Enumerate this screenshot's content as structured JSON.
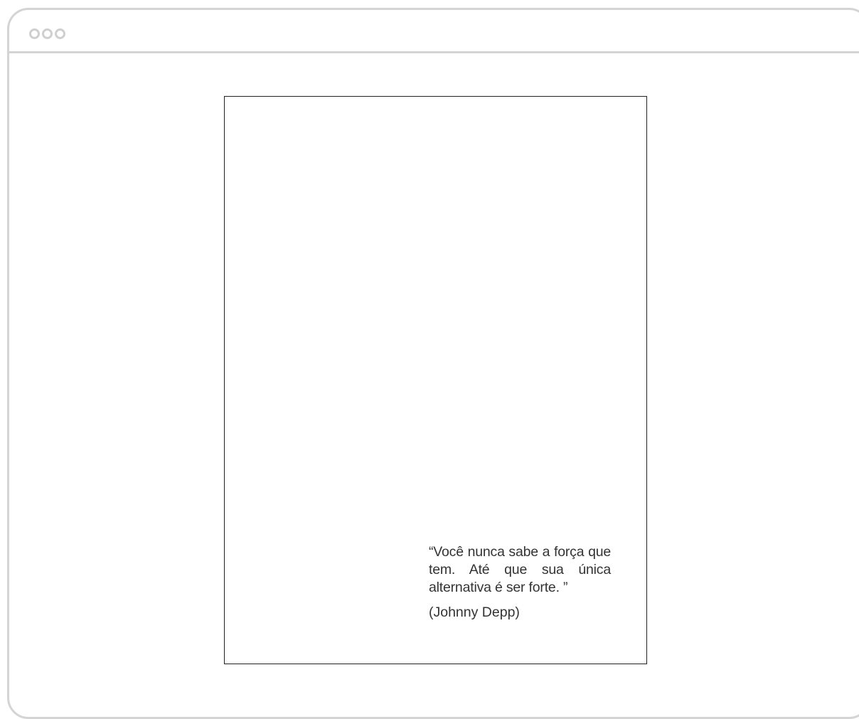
{
  "window": {
    "controls": [
      "window-dot-1",
      "window-dot-2",
      "window-dot-3"
    ]
  },
  "page": {
    "quote": "“Você nunca sabe a força que tem. Até que sua única alternativa é ser forte. ”",
    "author": "(Johnny Depp)"
  },
  "colors": {
    "frame": "#d4d4d4",
    "page_border": "#222222",
    "text": "#333333"
  }
}
